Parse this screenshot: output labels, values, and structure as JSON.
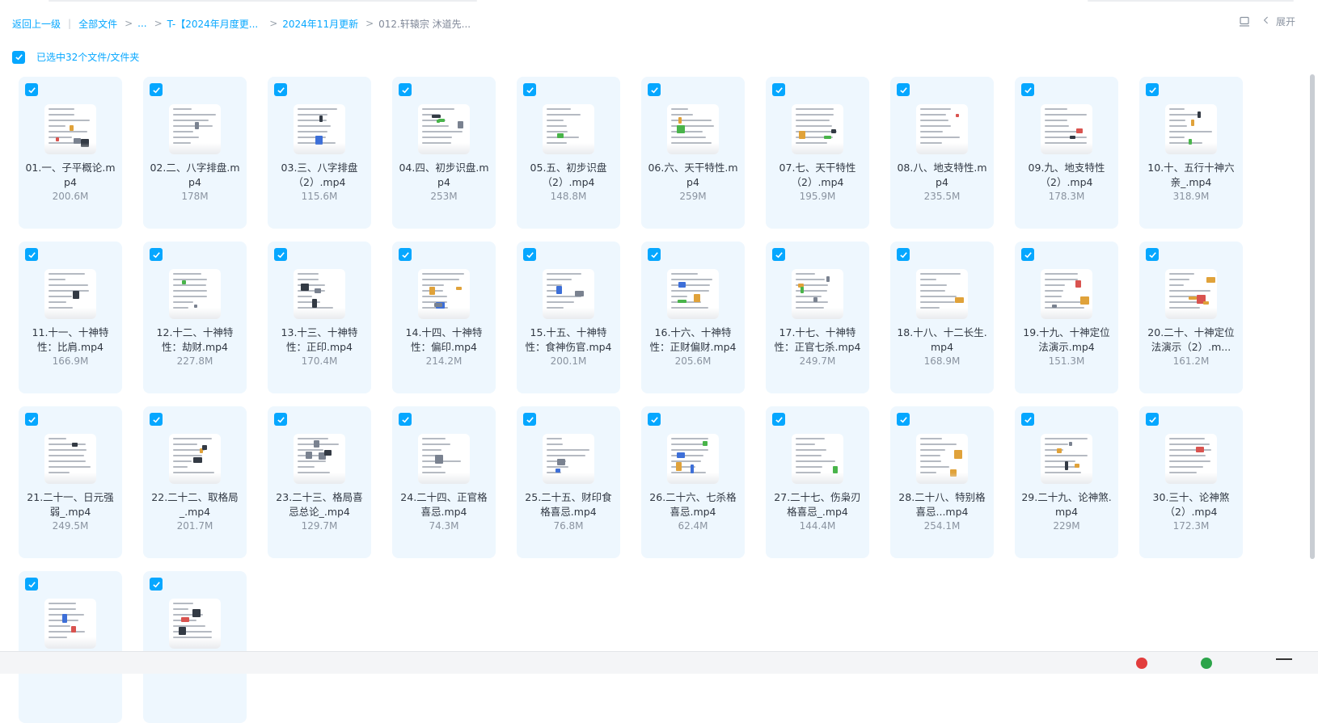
{
  "breadcrumb": {
    "back": "返回上一级",
    "divider": "|",
    "all_files": "全部文件",
    "ellipsis": "...",
    "crumb1": "T-【2024年月度更...",
    "crumb2": "2024年11月更新",
    "current": "012.轩辕宗 沐道先..."
  },
  "toolbar": {
    "expand_label": "展开"
  },
  "selection": {
    "label": "已选中32个文件/文件夹"
  },
  "files": [
    {
      "name": "01.一、子平概论.mp4",
      "size": "200.6M"
    },
    {
      "name": "02.二、八字排盘.mp4",
      "size": "178M"
    },
    {
      "name": "03.三、八字排盘（2）.mp4",
      "size": "115.6M"
    },
    {
      "name": "04.四、初步识盘.mp4",
      "size": "253M"
    },
    {
      "name": "05.五、初步识盘（2）.mp4",
      "size": "148.8M"
    },
    {
      "name": "06.六、天干特性.mp4",
      "size": "259M"
    },
    {
      "name": "07.七、天干特性（2）.mp4",
      "size": "195.9M"
    },
    {
      "name": "08.八、地支特性.mp4",
      "size": "235.5M"
    },
    {
      "name": "09.九、地支特性（2）.mp4",
      "size": "178.3M"
    },
    {
      "name": "10.十、五行十神六亲_.mp4",
      "size": "318.9M"
    },
    {
      "name": "11.十一、十神特性：比肩.mp4",
      "size": "166.9M"
    },
    {
      "name": "12.十二、十神特性：劫财.mp4",
      "size": "227.8M"
    },
    {
      "name": "13.十三、十神特性：正印.mp4",
      "size": "170.4M"
    },
    {
      "name": "14.十四、十神特性：偏印.mp4",
      "size": "214.2M"
    },
    {
      "name": "15.十五、十神特性：食神伤官.mp4",
      "size": "200.1M"
    },
    {
      "name": "16.十六、十神特性：正财偏财.mp4",
      "size": "205.6M"
    },
    {
      "name": "17.十七、十神特性：正官七杀.mp4",
      "size": "249.7M"
    },
    {
      "name": "18.十八、十二长生.mp4",
      "size": "168.9M"
    },
    {
      "name": "19.十九、十神定位法演示.mp4",
      "size": "151.3M"
    },
    {
      "name": "20.二十、十神定位法演示（2）.m...",
      "size": "161.2M"
    },
    {
      "name": "21.二十一、日元强弱_.mp4",
      "size": "249.5M"
    },
    {
      "name": "22.二十二、取格局_.mp4",
      "size": "201.7M"
    },
    {
      "name": "23.二十三、格局喜忌总论_.mp4",
      "size": "129.7M"
    },
    {
      "name": "24.二十四、正官格喜忌.mp4",
      "size": "74.3M"
    },
    {
      "name": "25.二十五、财印食格喜忌.mp4",
      "size": "76.8M"
    },
    {
      "name": "26.二十六、七杀格喜忌.mp4",
      "size": "62.4M"
    },
    {
      "name": "27.二十七、伤枭刃格喜忌_.mp4",
      "size": "144.4M"
    },
    {
      "name": "28.二十八、特别格喜忌...mp4",
      "size": "254.1M"
    },
    {
      "name": "29.二十九、论神煞.mp4",
      "size": "229M"
    },
    {
      "name": "30.三十、论神煞（2）.mp4",
      "size": "172.3M"
    },
    {
      "name": "",
      "size": ""
    },
    {
      "name": "",
      "size": ""
    }
  ],
  "colors": {
    "accent": "#06a7ff",
    "card_bg": "#eef7fe"
  }
}
